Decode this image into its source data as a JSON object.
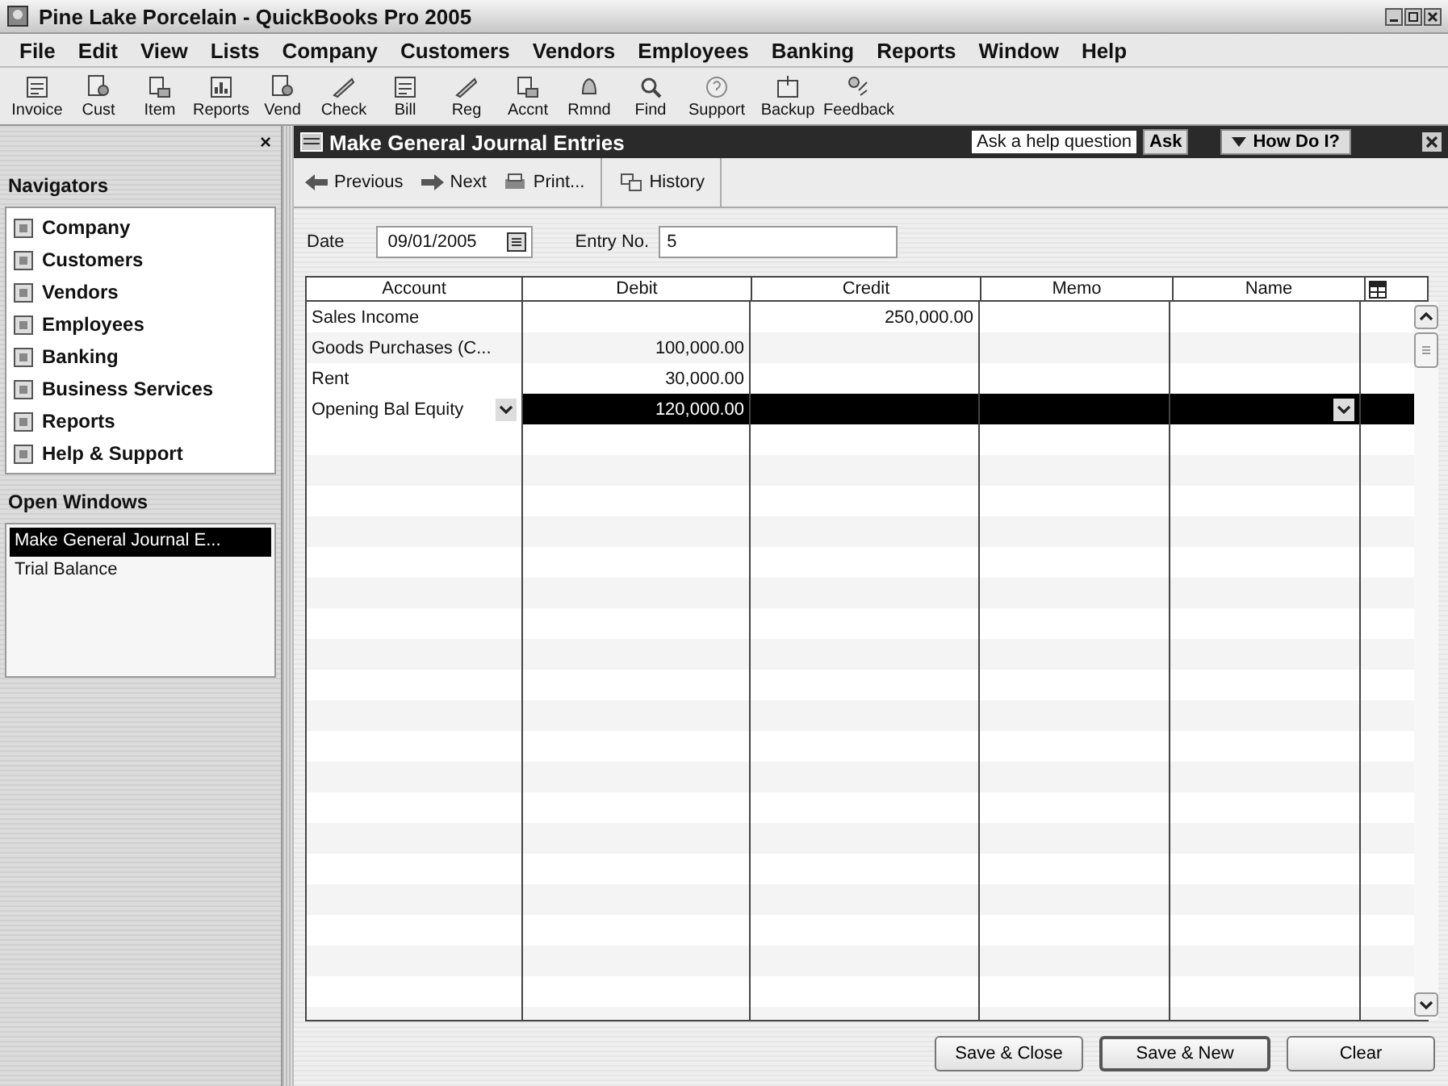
{
  "window": {
    "title": "Pine Lake Porcelain - QuickBooks Pro 2005"
  },
  "menu": [
    "File",
    "Edit",
    "View",
    "Lists",
    "Company",
    "Customers",
    "Vendors",
    "Employees",
    "Banking",
    "Reports",
    "Window",
    "Help"
  ],
  "toolbar": [
    {
      "label": "Invoice"
    },
    {
      "label": "Cust"
    },
    {
      "label": "Item"
    },
    {
      "label": "Reports"
    },
    {
      "label": "Vend"
    },
    {
      "label": "Check"
    },
    {
      "label": "Bill"
    },
    {
      "label": "Reg"
    },
    {
      "label": "Accnt"
    },
    {
      "label": "Rmnd"
    },
    {
      "label": "Find"
    },
    {
      "label": "Support"
    },
    {
      "label": "Backup"
    },
    {
      "label": "Feedback"
    }
  ],
  "sidebar": {
    "close": "×",
    "navigators_title": "Navigators",
    "navigators": [
      {
        "label": "Company"
      },
      {
        "label": "Customers"
      },
      {
        "label": "Vendors"
      },
      {
        "label": "Employees"
      },
      {
        "label": "Banking"
      },
      {
        "label": "Business Services"
      },
      {
        "label": "Reports"
      },
      {
        "label": "Help & Support"
      }
    ],
    "open_windows_title": "Open Windows",
    "open_windows": [
      {
        "label": "Make General Journal E...",
        "selected": true
      },
      {
        "label": "Trial Balance",
        "selected": false
      }
    ]
  },
  "journal": {
    "title": "Make General Journal Entries",
    "help_placeholder": "Ask a help question",
    "ask": "Ask",
    "how_do_i": "How Do I?",
    "actions": [
      {
        "label": "Previous"
      },
      {
        "label": "Next"
      },
      {
        "label": "Print..."
      },
      {
        "label": "History"
      }
    ],
    "date_label": "Date",
    "date": "09/01/2005",
    "entry_label": "Entry No.",
    "entry_no": "5",
    "columns": [
      "Account",
      "Debit",
      "Credit",
      "Memo",
      "Name"
    ],
    "rows": [
      {
        "account": "Sales Income",
        "credit": "250,000.00",
        "selected": false
      },
      {
        "account": "Goods Purchases (C...",
        "debit": "100,000.00",
        "selected": false
      },
      {
        "account": "Rent",
        "debit": "30,000.00",
        "selected": false
      },
      {
        "account": "Opening Bal Equity",
        "debit": "120,000.00",
        "selected": true
      }
    ],
    "buttons": [
      "Save & Close",
      "Save & New",
      "Clear"
    ]
  }
}
